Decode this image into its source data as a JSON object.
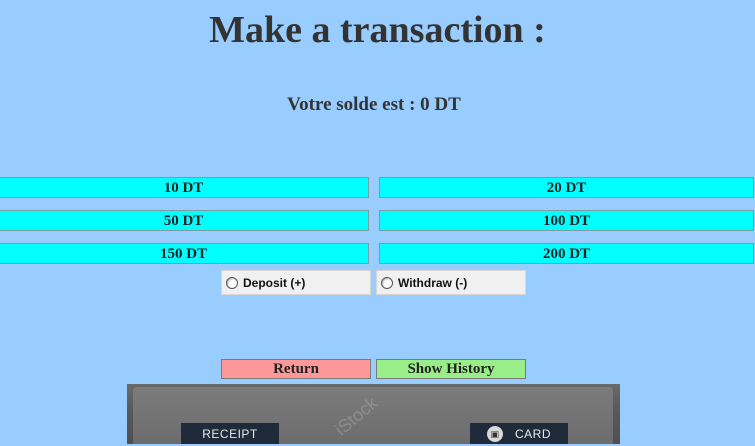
{
  "header": {
    "title": "Make a transaction :",
    "balance_text": "Votre solde est : 0 DT"
  },
  "amounts": [
    {
      "label": "10 DT"
    },
    {
      "label": "20 DT"
    },
    {
      "label": "50 DT"
    },
    {
      "label": "100 DT"
    },
    {
      "label": "150 DT"
    },
    {
      "label": "200 DT"
    }
  ],
  "radio": {
    "deposit_label": "Deposit (+)",
    "withdraw_label": "Withdraw (-)"
  },
  "buttons": {
    "return_label": "Return",
    "history_label": "Show History"
  },
  "image": {
    "receipt_label": "RECEIPT",
    "card_label": "CARD",
    "watermark": "iStock"
  },
  "colors": {
    "background": "#99ccff",
    "amount_button": "#00ffff",
    "return_button": "#ff9999",
    "history_button": "#99ee88"
  }
}
